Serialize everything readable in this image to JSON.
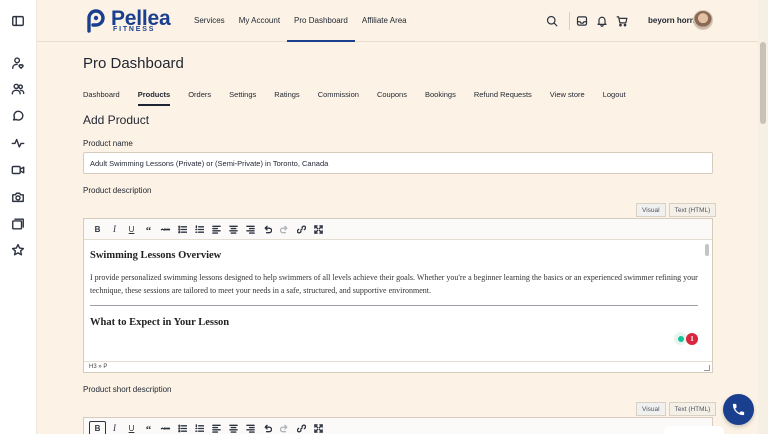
{
  "brand": {
    "name": "Pellea",
    "sub": "FITNESS",
    "color": "#1b3f8f"
  },
  "rail_icons": [
    "sidebar-toggle-icon",
    "user-heart-icon",
    "users-icon",
    "chat-icon",
    "activity-icon",
    "video-icon",
    "camera-icon",
    "gallery-icon",
    "star-icon"
  ],
  "nav": {
    "services": "Services",
    "account": "My Account",
    "dashboard": "Pro Dashboard",
    "affiliate": "Affiliate Area"
  },
  "header": {
    "username": "beyorn horn"
  },
  "page": {
    "title": "Pro Dashboard",
    "subnav": {
      "dashboard": "Dashboard",
      "products": "Products",
      "orders": "Orders",
      "settings": "Settings",
      "ratings": "Ratings",
      "commission": "Commission",
      "coupons": "Coupons",
      "bookings": "Bookings",
      "refunds": "Refund Requests",
      "store": "View store",
      "logout": "Logout"
    },
    "section_title": "Add Product"
  },
  "form": {
    "name_label": "Product name",
    "name_value": "Adult Swimming Lessons (Private) or (Semi-Private) in Toronto, Canada",
    "desc_label": "Product description",
    "short_label": "Product short description",
    "tab_visual": "Visual",
    "tab_html": "Text (HTML)",
    "toolbar": {
      "bold": "B",
      "italic": "I",
      "underline": "U",
      "quote": "“",
      "strike": "ABC"
    },
    "editor": {
      "heading1": "Swimming Lessons Overview",
      "paragraph1": "I provide personalized swimming lessons designed to help swimmers of all levels achieve their goals. Whether you're a beginner learning the basics or an experienced swimmer refining your technique, these sessions are tailored to meet your needs in a safe, structured, and supportive environment.",
      "heading2": "What to Expect in Your Lesson",
      "status_path": "H3 » P",
      "grammar_count": "1"
    }
  }
}
